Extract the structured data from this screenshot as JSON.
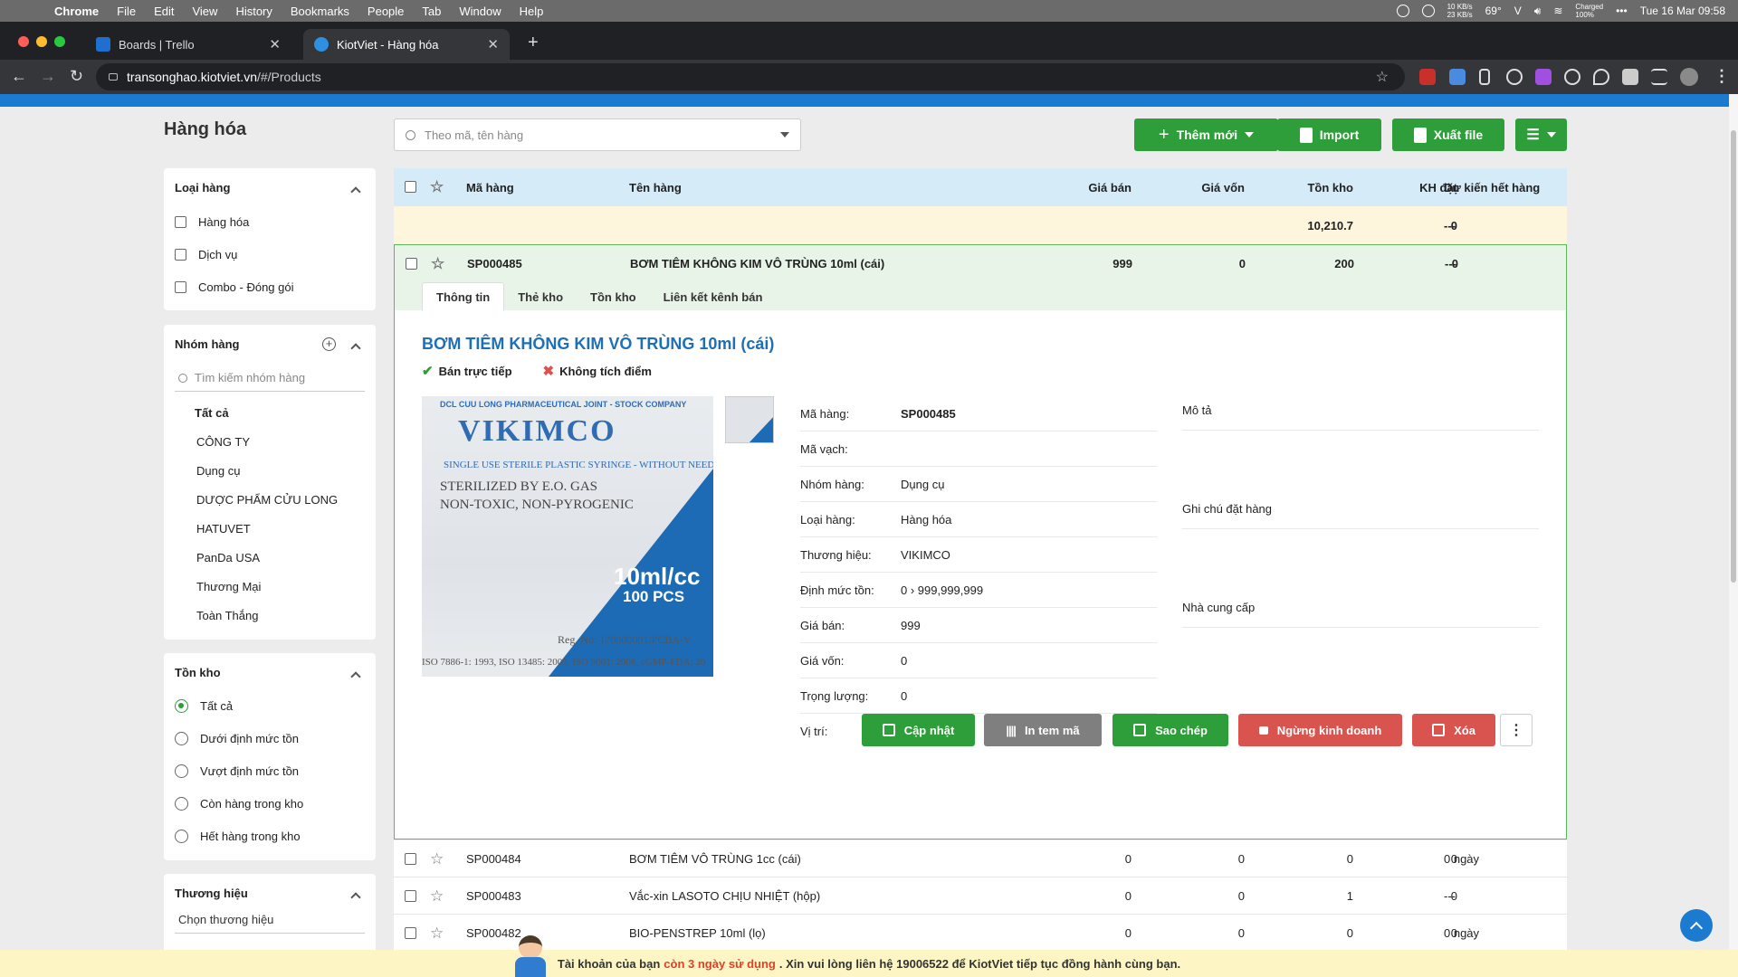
{
  "menubar": {
    "app": "Chrome",
    "items": [
      "File",
      "Edit",
      "View",
      "History",
      "Bookmarks",
      "People",
      "Tab",
      "Window",
      "Help"
    ],
    "net_up": "10 KB/s",
    "net_down": "23 KB/s",
    "temp": "69°",
    "battery_state": "Charged",
    "battery_pct": "100%",
    "datetime": "Tue 16 Mar  09:58"
  },
  "browser": {
    "tabs": [
      {
        "title": "Boards | Trello",
        "favicon_color": "#1f6fd1",
        "active": false
      },
      {
        "title": "KiotViet - Hàng hóa",
        "favicon_color": "#2f8fe0",
        "active": true
      }
    ],
    "url_host": "transonghao.kiotviet.vn",
    "url_path": "/#/Products"
  },
  "page": {
    "title": "Hàng hóa",
    "search_placeholder": "Theo mã, tên hàng",
    "buttons": {
      "add": "Thêm mới",
      "import": "Import",
      "export": "Xuất file"
    }
  },
  "sidebar": {
    "product_type": {
      "title": "Loại hàng",
      "options": [
        "Hàng hóa",
        "Dịch vụ",
        "Combo - Đóng gói"
      ]
    },
    "group": {
      "title": "Nhóm hàng",
      "search_placeholder": "Tìm kiếm nhóm hàng",
      "items": [
        "Tất cả",
        "CÔNG TY",
        "Dụng cụ",
        "DƯỢC PHẨM CỬU LONG",
        "HATUVET",
        "PanDa USA",
        "Thương Mại",
        "Toàn Thắng"
      ]
    },
    "stock": {
      "title": "Tồn kho",
      "options": [
        "Tất cả",
        "Dưới định mức tồn",
        "Vượt định mức tồn",
        "Còn hàng trong kho",
        "Hết hàng trong kho"
      ],
      "selected": "Tất cả"
    },
    "brand": {
      "title": "Thương hiệu",
      "placeholder": "Chọn thương hiệu"
    }
  },
  "table": {
    "columns": [
      "Mã hàng",
      "Tên hàng",
      "Giá bán",
      "Giá vốn",
      "Tồn kho",
      "KH đặt",
      "Dự kiến hết hàng"
    ],
    "summary": {
      "stock": "10,210.7",
      "ordered": "0",
      "eta": "---"
    },
    "expanded_row": {
      "code": "SP000485",
      "name": "BƠM TIÊM KHÔNG KIM VÔ TRÙNG 10ml (cái)",
      "price": "999",
      "cost": "0",
      "stock": "200",
      "ordered": "0",
      "eta": "---"
    },
    "rows": [
      {
        "code": "SP000484",
        "name": "BƠM TIÊM VÔ TRÙNG 1cc (cái)",
        "price": "0",
        "cost": "0",
        "stock": "0",
        "ordered": "0",
        "eta": "0 ngày"
      },
      {
        "code": "SP000483",
        "name": "Vắc-xin LASOTO CHỊU NHIỆT (hộp)",
        "price": "0",
        "cost": "0",
        "stock": "1",
        "ordered": "0",
        "eta": "---"
      },
      {
        "code": "SP000482",
        "name": "BIO-PENSTREP 10ml (lọ)",
        "price": "0",
        "cost": "0",
        "stock": "0",
        "ordered": "0",
        "eta": "0 ngày"
      }
    ]
  },
  "detail": {
    "tabs": [
      "Thông tin",
      "Thẻ kho",
      "Tồn kho",
      "Liên kết kênh bán"
    ],
    "title": "BƠM TIÊM KHÔNG KIM VÔ TRÙNG 10ml (cái)",
    "flag_direct": "Bán trực tiếp",
    "flag_no_points": "Không tích điểm",
    "image": {
      "company": "DCL  CUU LONG PHARMACEUTICAL JOINT - STOCK COMPANY",
      "brand": "VIKIMCO",
      "line1": "SINGLE USE STERILE PLASTIC SYRINGE - WITHOUT NEEDLE",
      "line2": "STERILIZED    BY  E.O.  GAS",
      "line3": "NON-TOXIC, NON-PYROGENIC",
      "volume": "10ml/cc",
      "pcs": "100 PCS",
      "reg": "Reg. No: 170000001/PCBA-V",
      "iso": "ISO 7886-1: 1993, ISO 13485: 2003, ISO 9001: 2008, cGMP-FDA: 20"
    },
    "fields": [
      {
        "label": "Mã hàng:",
        "value": "SP000485",
        "bold": true
      },
      {
        "label": "Mã vạch:",
        "value": ""
      },
      {
        "label": "Nhóm hàng:",
        "value": "Dụng cụ"
      },
      {
        "label": "Loại hàng:",
        "value": "Hàng hóa"
      },
      {
        "label": "Thương hiệu:",
        "value": "VIKIMCO"
      },
      {
        "label": "Định mức tồn:",
        "value": "0  ›  999,999,999"
      },
      {
        "label": "Giá bán:",
        "value": "999"
      },
      {
        "label": "Giá vốn:",
        "value": "0"
      },
      {
        "label": "Trọng lượng:",
        "value": "0"
      },
      {
        "label": "Vị trí:",
        "value": ""
      }
    ],
    "right_labels": {
      "description": "Mô tả",
      "order_note": "Ghi chú đặt hàng",
      "supplier": "Nhà cung cấp"
    },
    "actions": {
      "update": "Cập nhật",
      "print": "In tem mã",
      "copy": "Sao chép",
      "stop": "Ngừng kinh doanh",
      "delete": "Xóa"
    }
  },
  "notice": {
    "prefix": "Tài khoản của bạn",
    "highlight": "còn 3 ngày sử dụng",
    "suffix": ". Xin vui lòng liên hệ 19006522 để KiotViet tiếp tục đồng hành cùng bạn."
  },
  "colors": {
    "primary_green": "#2e9e3a",
    "brand_blue": "#1a7bd0",
    "danger_red": "#d9534f",
    "gray_button": "#7f7f7f"
  }
}
